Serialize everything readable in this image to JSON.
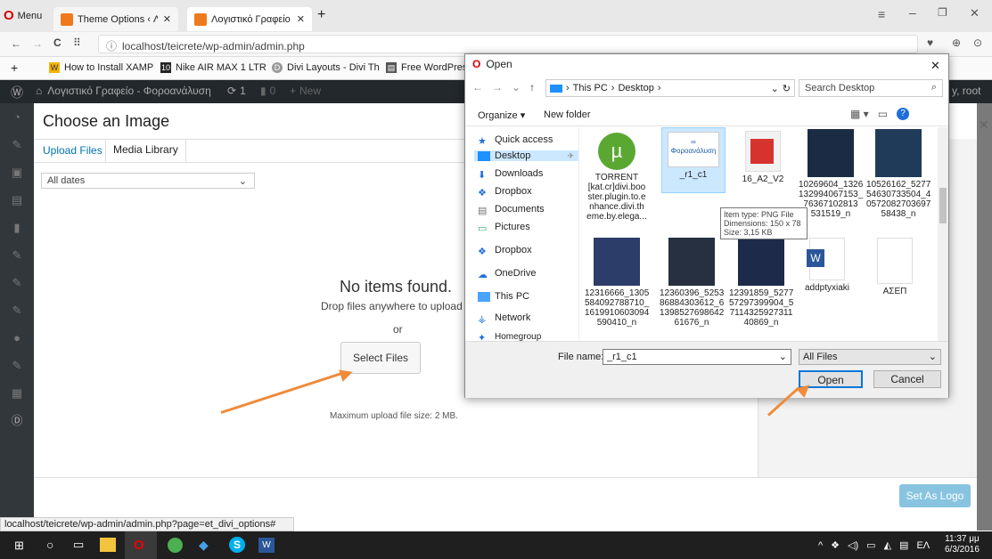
{
  "browser": {
    "menu_label": "Menu",
    "tabs": [
      {
        "label": "Theme Options ‹ Λογιστι"
      },
      {
        "label": "Λογιστικό Γραφείο – Φορ"
      }
    ],
    "new_tab": "+",
    "url": "localhost/teicrete/wp-admin/admin.php",
    "bookmarks": [
      "How to Install XAMP",
      "Nike AIR MAX 1 LTR",
      "Divi Layouts - Divi Th",
      "Free WordPress Th"
    ],
    "status_url": "localhost/teicrete/wp-admin/admin.php?page=et_divi_options#"
  },
  "wp": {
    "site_name": "Λογιστικό Γραφείο - Φοροανάλυση",
    "updates": "1",
    "comments": "0",
    "new_label": "New",
    "user": "y, root"
  },
  "media_modal": {
    "title": "Choose an Image",
    "tabs": [
      "Upload Files",
      "Media Library"
    ],
    "filter": "All dates",
    "empty_title": "No items found.",
    "drop_text": "Drop files anywhere to upload",
    "or_text": "or",
    "select_files": "Select Files",
    "max_size": "Maximum upload file size: 2 MB.",
    "set_logo": "Set As Logo"
  },
  "open_dialog": {
    "title": "Open",
    "breadcrumb": [
      "This PC",
      "Desktop"
    ],
    "search_placeholder": "Search Desktop",
    "organize": "Organize ▾",
    "new_folder": "New folder",
    "nav": [
      "Quick access",
      "Desktop",
      "Downloads",
      "Dropbox",
      "Documents",
      "Pictures",
      "Dropbox",
      "OneDrive",
      "This PC",
      "Network"
    ],
    "files": [
      {
        "name": "TORRENT\n[kat.cr]divi.boo ster.plugin.to.e nhance.divi.th eme.by.elega..."
      },
      {
        "name": "_r1_c1"
      },
      {
        "name": "16_A2_V2"
      },
      {
        "name": "10269604_1326 132994067153_ 76367102813 531519_n"
      },
      {
        "name": "10526162_5277 54630733504_4 0572082703697 58438_n"
      },
      {
        "name": "12316666_1305 584092788710_ 1619910603094 590410_n"
      },
      {
        "name": "12360396_5253 86884303612_6 1398527698642 61676_n"
      },
      {
        "name": "12391859_5277 57297399904_5 7114325927311 40869_n"
      },
      {
        "name": "addptyxiaki"
      },
      {
        "name": "ΑΣΕΠ"
      }
    ],
    "tooltip": [
      "Item type: PNG File",
      "Dimensions: 150 x 78",
      "Size: 3,15 KB"
    ],
    "file_name_label": "File name:",
    "file_name_value": "_r1_c1",
    "file_type": "All Files",
    "open_btn": "Open",
    "cancel_btn": "Cancel"
  },
  "taskbar": {
    "time": "11:37 μμ",
    "date": "6/3/2016",
    "lang": "ΕΛ"
  },
  "colors": {
    "accent": "#0073aa",
    "arrow": "#ef8b3b"
  }
}
